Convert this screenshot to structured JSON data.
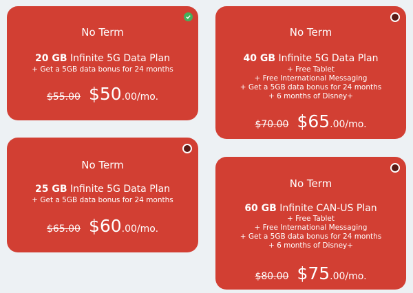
{
  "plans": [
    {
      "term": "No Term",
      "gb": "20 GB",
      "plan_name": "Infinite 5G Data Plan",
      "extras": [
        "+ Get a 5GB data bonus for 24 months"
      ],
      "old_price": "$55.00",
      "new_price_main": "$50",
      "new_price_tail": ".00/mo.",
      "selected": true
    },
    {
      "term": "No Term",
      "gb": "40 GB",
      "plan_name": "Infinite 5G Data Plan",
      "extras": [
        "+ Free Tablet",
        "+ Free International Messaging",
        "+ Get a 5GB data bonus for 24 months",
        "+ 6 months of Disney+"
      ],
      "old_price": "$70.00",
      "new_price_main": "$65",
      "new_price_tail": ".00/mo.",
      "selected": false
    },
    {
      "term": "No Term",
      "gb": "25 GB",
      "plan_name": "Infinite 5G Data Plan",
      "extras": [
        "+ Get a 5GB data bonus for 24 months"
      ],
      "old_price": "$65.00",
      "new_price_main": "$60",
      "new_price_tail": ".00/mo.",
      "selected": false
    },
    {
      "term": "No Term",
      "gb": "60 GB",
      "plan_name": "Infinite CAN-US Plan",
      "extras": [
        "+ Free Tablet",
        "+ Free International Messaging",
        "+ Get a 5GB data bonus for 24 months",
        "+ 6 months of Disney+"
      ],
      "old_price": "$80.00",
      "new_price_main": "$75",
      "new_price_tail": ".00/mo.",
      "selected": false
    }
  ],
  "colors": {
    "card": "#d23f33",
    "background": "#edf1f4",
    "check": "#43b05c"
  },
  "icons": {
    "selected": "check-circle-icon",
    "unselected": "radio-icon"
  }
}
